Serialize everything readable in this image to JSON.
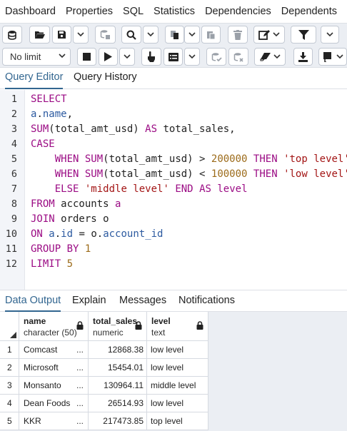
{
  "top_tabs": [
    "Dashboard",
    "Properties",
    "SQL",
    "Statistics",
    "Dependencies",
    "Dependents"
  ],
  "toolbar": {
    "limit_value": "No limit"
  },
  "query_tabs": [
    {
      "label": "Query Editor",
      "active": true
    },
    {
      "label": "Query History",
      "active": false
    }
  ],
  "editor": {
    "line_numbers": [
      "1",
      "2",
      "3",
      "4",
      "5",
      "6",
      "7",
      "8",
      "9",
      "10",
      "11",
      "12"
    ]
  },
  "output_tabs": [
    {
      "label": "Data Output",
      "active": true
    },
    {
      "label": "Explain",
      "active": false
    },
    {
      "label": "Messages",
      "active": false
    },
    {
      "label": "Notifications",
      "active": false
    }
  ],
  "grid": {
    "columns": [
      {
        "name": "name",
        "type": "character (50)"
      },
      {
        "name": "total_sales",
        "type": "numeric"
      },
      {
        "name": "level",
        "type": "text"
      }
    ],
    "rows": [
      {
        "num": "1",
        "name": "Comcast",
        "dots": "...",
        "total_sales": "12868.38",
        "level": "low level"
      },
      {
        "num": "2",
        "name": "Microsoft",
        "dots": "...",
        "total_sales": "15454.01",
        "level": "low level"
      },
      {
        "num": "3",
        "name": "Monsanto",
        "dots": "...",
        "total_sales": "130964.11",
        "level": "middle level"
      },
      {
        "num": "4",
        "name": "Dean Foods",
        "dots": "...",
        "total_sales": "26514.93",
        "level": "low level"
      },
      {
        "num": "5",
        "name": "KKR",
        "dots": "...",
        "total_sales": "217473.85",
        "level": "top level"
      }
    ]
  },
  "colors": {
    "accent": "#326690",
    "keyword": "#9b0b84",
    "number": "#9c6b1a",
    "string": "#a31515",
    "identifier": "#2c5aa0"
  }
}
